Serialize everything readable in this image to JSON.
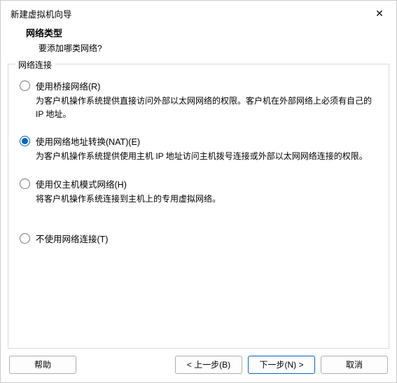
{
  "window": {
    "title": "新建虚拟机向导",
    "close_glyph": "✕"
  },
  "header": {
    "heading": "网络类型",
    "sub": "要添加哪类网络?"
  },
  "group": {
    "legend": "网络连接"
  },
  "options": {
    "bridged": {
      "label": "使用桥接网络(R)",
      "desc": "为客户机操作系统提供直接访问外部以太网网络的权限。客户机在外部网络上必须有自己的 IP 地址。",
      "checked": false
    },
    "nat": {
      "label": "使用网络地址转换(NAT)(E)",
      "desc": "为客户机操作系统提供使用主机 IP 地址访问主机拨号连接或外部以太网网络连接的权限。",
      "checked": true
    },
    "hostonly": {
      "label": "使用仅主机模式网络(H)",
      "desc": "将客户机操作系统连接到主机上的专用虚拟网络。",
      "checked": false
    },
    "none": {
      "label": "不使用网络连接(T)",
      "checked": false
    }
  },
  "buttons": {
    "help": "帮助",
    "back": "< 上一步(B)",
    "next": "下一步(N) >",
    "cancel": "取消"
  }
}
